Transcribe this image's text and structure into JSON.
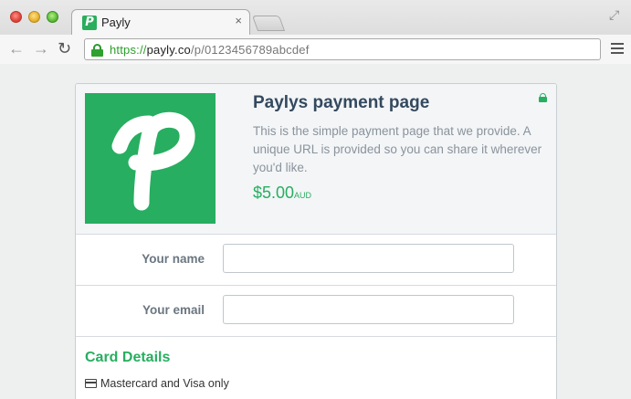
{
  "browser": {
    "tab_title": "Payly",
    "tab_favicon_letter": "P",
    "tab_close": "×",
    "url_protocol": "https://",
    "url_host": "payly.co",
    "url_path": "/p/0123456789abcdef",
    "back_icon": "←",
    "forward_icon": "→",
    "reload_icon": "↻",
    "fullscreen_icon": "⤢"
  },
  "payment": {
    "title": "Paylys payment page",
    "description": "This is the simple payment page that we provide. A unique URL is provided so you can share it wherever you'd like.",
    "amount": "$5.00",
    "currency": "AUD",
    "brand_color": "#27ae60"
  },
  "form": {
    "name_label": "Your name",
    "name_value": "",
    "email_label": "Your email",
    "email_value": ""
  },
  "card": {
    "heading": "Card Details",
    "note": "Mastercard and Visa only"
  }
}
